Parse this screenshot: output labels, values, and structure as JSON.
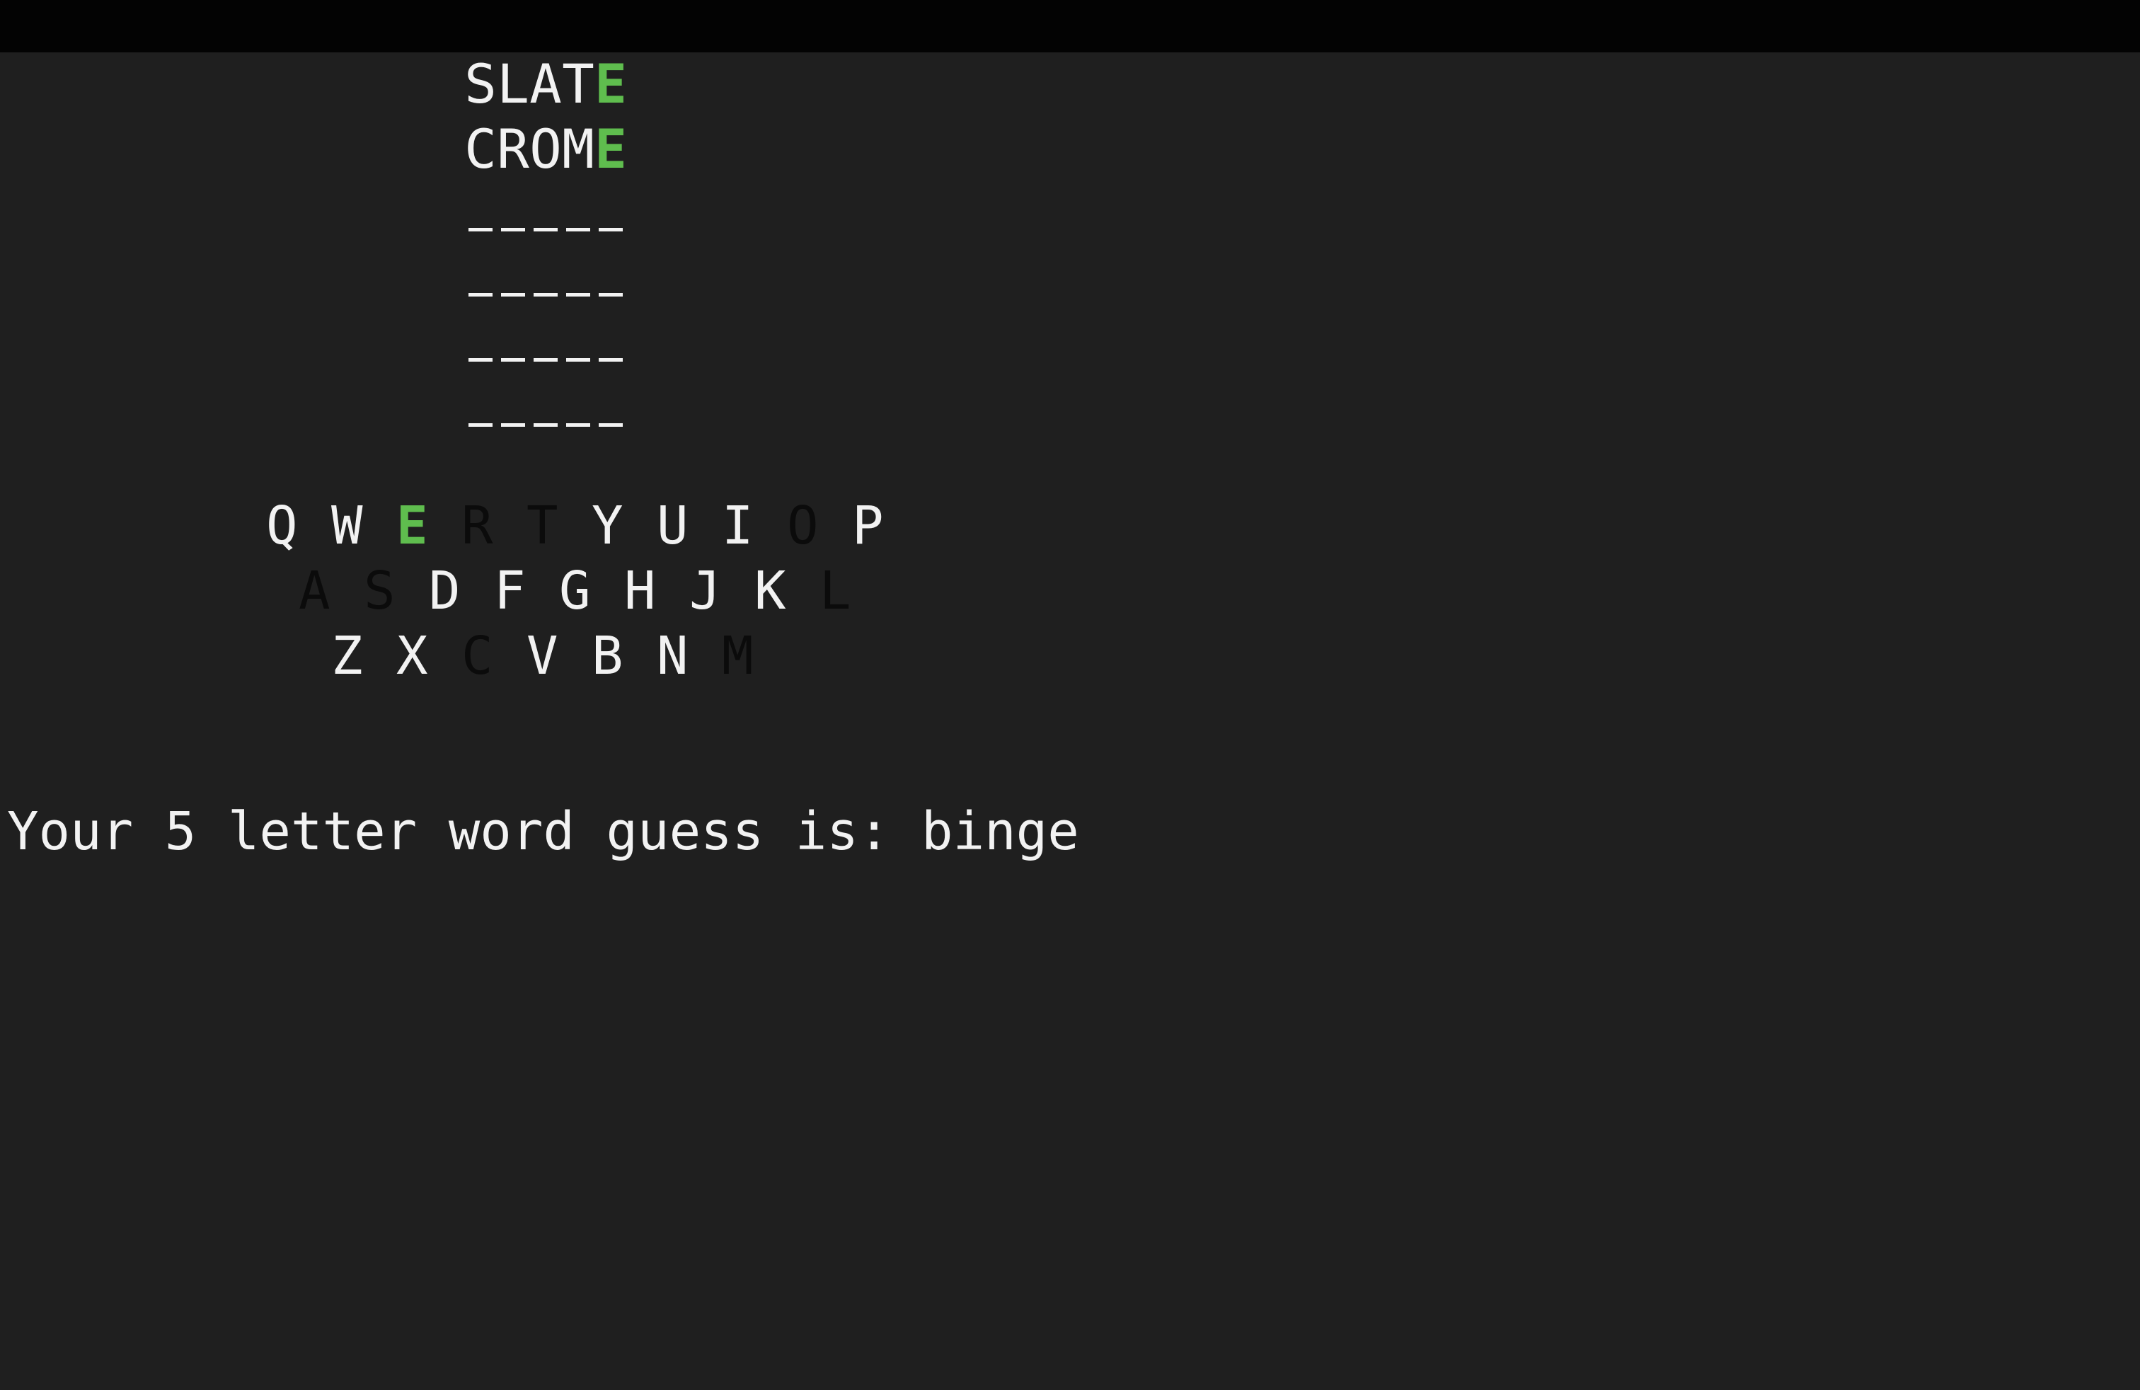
{
  "colors": {
    "background": "#1f1f1f",
    "titlebar": "#030303",
    "text": "#f2f2f2",
    "correct": "#5fbd4e",
    "absent": "#0b0b0b"
  },
  "guesses": [
    {
      "letters": [
        {
          "char": "S",
          "state": "unused"
        },
        {
          "char": "L",
          "state": "unused"
        },
        {
          "char": "A",
          "state": "unused"
        },
        {
          "char": "T",
          "state": "unused"
        },
        {
          "char": "E",
          "state": "correct"
        }
      ]
    },
    {
      "letters": [
        {
          "char": "C",
          "state": "unused"
        },
        {
          "char": "R",
          "state": "unused"
        },
        {
          "char": "O",
          "state": "unused"
        },
        {
          "char": "M",
          "state": "unused"
        },
        {
          "char": "E",
          "state": "correct"
        }
      ]
    }
  ],
  "empty_rows": 4,
  "keyboard": {
    "rows": [
      [
        {
          "char": "Q",
          "state": "unused"
        },
        {
          "char": "W",
          "state": "unused"
        },
        {
          "char": "E",
          "state": "correct"
        },
        {
          "char": "R",
          "state": "absent"
        },
        {
          "char": "T",
          "state": "absent"
        },
        {
          "char": "Y",
          "state": "unused"
        },
        {
          "char": "U",
          "state": "unused"
        },
        {
          "char": "I",
          "state": "unused"
        },
        {
          "char": "O",
          "state": "absent"
        },
        {
          "char": "P",
          "state": "unused"
        }
      ],
      [
        {
          "char": "A",
          "state": "absent"
        },
        {
          "char": "S",
          "state": "absent"
        },
        {
          "char": "D",
          "state": "unused"
        },
        {
          "char": "F",
          "state": "unused"
        },
        {
          "char": "G",
          "state": "unused"
        },
        {
          "char": "H",
          "state": "unused"
        },
        {
          "char": "J",
          "state": "unused"
        },
        {
          "char": "K",
          "state": "unused"
        },
        {
          "char": "L",
          "state": "absent"
        }
      ],
      [
        {
          "char": "Z",
          "state": "unused"
        },
        {
          "char": "X",
          "state": "unused"
        },
        {
          "char": "C",
          "state": "absent"
        },
        {
          "char": "V",
          "state": "unused"
        },
        {
          "char": "B",
          "state": "unused"
        },
        {
          "char": "N",
          "state": "unused"
        },
        {
          "char": "M",
          "state": "absent"
        }
      ]
    ]
  },
  "prompt": {
    "label": "Your 5 letter word guess is: ",
    "input": "binge"
  }
}
